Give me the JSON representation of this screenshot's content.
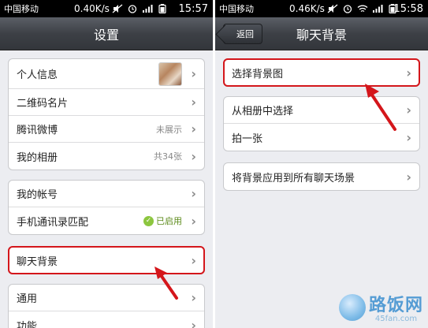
{
  "left": {
    "status": {
      "carrier": "中国移动",
      "speed": "0.40K/s",
      "time": "15:57"
    },
    "title": "设置",
    "groups": [
      {
        "rows": [
          {
            "label": "个人信息",
            "value": ""
          },
          {
            "label": "二维码名片",
            "value": ""
          },
          {
            "label": "腾讯微博",
            "value": "未展示"
          },
          {
            "label": "我的相册",
            "value": "共34张"
          }
        ]
      },
      {
        "rows": [
          {
            "label": "我的帐号",
            "value": ""
          },
          {
            "label": "手机通讯录匹配",
            "value": "已启用"
          }
        ]
      },
      {
        "rows": [
          {
            "label": "聊天背景",
            "value": ""
          }
        ]
      },
      {
        "rows": [
          {
            "label": "通用",
            "value": ""
          },
          {
            "label": "功能",
            "value": ""
          }
        ]
      }
    ]
  },
  "right": {
    "status": {
      "carrier": "中国移动",
      "speed": "0.46K/s",
      "time": "15:58"
    },
    "back_label": "返回",
    "title": "聊天背景",
    "groups": [
      {
        "rows": [
          {
            "label": "选择背景图"
          }
        ]
      },
      {
        "rows": [
          {
            "label": "从相册中选择"
          },
          {
            "label": "拍一张"
          }
        ]
      },
      {
        "rows": [
          {
            "label": "将背景应用到所有聊天场景"
          }
        ]
      }
    ]
  },
  "watermark": {
    "main": "路饭网",
    "sub": "45fan.com"
  },
  "colors": {
    "highlight": "#d4161b",
    "navbar": "#3d4046",
    "background": "#ecedf1",
    "enabled_green": "#8cc63f"
  }
}
